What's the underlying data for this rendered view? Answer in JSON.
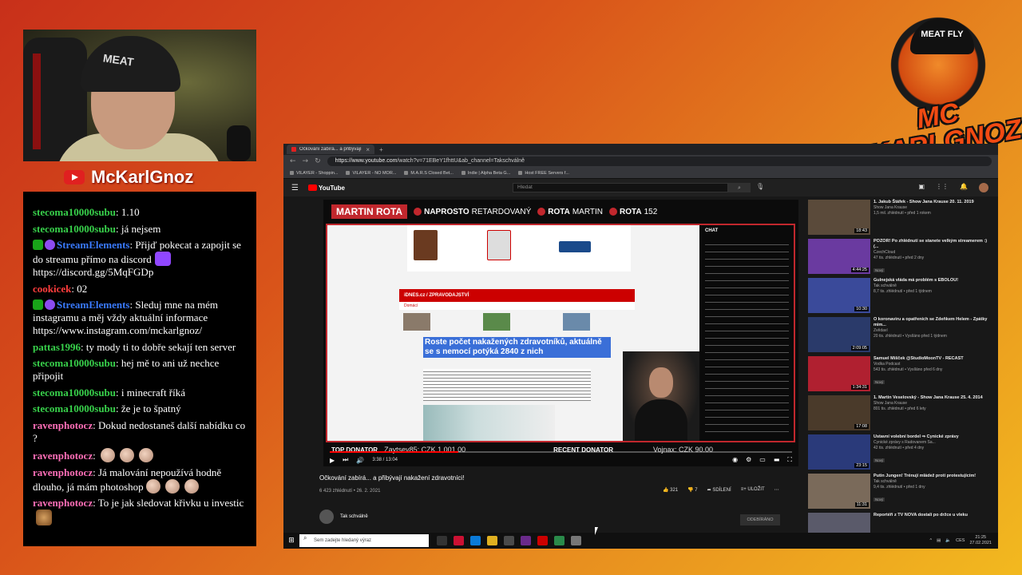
{
  "stream": {
    "channel_name": "McKarlGnoz",
    "logo_top": "MEAT FLY",
    "logo_name": "MC KARLGNOZ",
    "webcam_cap_text": "MEAT"
  },
  "chat": [
    {
      "user": "stecoma10000subu",
      "color": "green",
      "badges": [],
      "text": "1.10"
    },
    {
      "user": "stecoma10000subu",
      "color": "green",
      "badges": [],
      "text": "já nejsem"
    },
    {
      "user": "StreamElements",
      "color": "blue",
      "badges": [
        "mod",
        "bot"
      ],
      "text": "Přijď pokecat a zapojit se do streamu přímo na discord",
      "emote_after": "purple",
      "text2": "https://discord.gg/5MqFGDp"
    },
    {
      "user": "cookicek",
      "color": "red",
      "badges": [],
      "text": "02"
    },
    {
      "user": "StreamElements",
      "color": "blue",
      "badges": [
        "mod",
        "bot"
      ],
      "text": "Sleduj mne na mém instagramu a měj vždy aktuální informace https://www.instagram.com/mckarlgnoz/"
    },
    {
      "user": "pattas1996",
      "color": "green",
      "badges": [],
      "text": "ty mody ti to dobře sekají ten server"
    },
    {
      "user": "stecoma10000subu",
      "color": "green",
      "badges": [],
      "text": "hej mě to ani už nechce připojit"
    },
    {
      "user": "stecoma10000subu",
      "color": "green",
      "badges": [],
      "text": "i minecraft říká"
    },
    {
      "user": "stecoma10000subu",
      "color": "green",
      "badges": [],
      "text": "že je to špatný"
    },
    {
      "user": "ravenphotocz",
      "color": "pink",
      "badges": [],
      "text": "Dokud nedostaneš další nabídku co ?"
    },
    {
      "user": "ravenphotocz",
      "color": "pink",
      "badges": [],
      "text": "",
      "emotes": 3
    },
    {
      "user": "ravenphotocz",
      "color": "pink",
      "badges": [],
      "text": "Já malování nepoužívá hodně dlouho, já mám photoshop",
      "emotes": 3
    },
    {
      "user": "ravenphotocz",
      "color": "pink",
      "badges": [],
      "text": "To je jak sledovat křivku u investic",
      "emote_after": "face"
    }
  ],
  "browser": {
    "tab_title": "Očkování zabírá... a přibývají nové...",
    "url_host": "https://www.youtube.com",
    "url_path": "/watch?v=71EBeY1fhttU&ab_channel=Takschválně",
    "bookmarks": [
      "VILAYER - Shoppin...",
      "VILAYER - NO MOR...",
      "M.A.R.S Closed Bet...",
      "Indie | Alpha Beta G...",
      "Host FREE Servers f..."
    ],
    "search_placeholder": "Hledat"
  },
  "player": {
    "overlay_name": "MARTIN ROTA",
    "overlay_items": [
      {
        "bold": "NAPROSTO",
        "thin": "RETARDOVANÝ"
      },
      {
        "bold": "ROTA",
        "thin": "MARTIN"
      },
      {
        "bold": "ROTA",
        "thin": "152"
      }
    ],
    "site_bar": "iDNES.cz / ZPRAVODAJSTVÍ",
    "site_sub": "Domácí",
    "headline": "Roste počet nakažených zdravotníků, aktuálně se s nemocí potýká 2840 z nich",
    "stream_chat_title": "CHAT",
    "top_donator_label": "TOP DONATOR",
    "top_donator_value": "Zaytsev85: CZK 1,001.00",
    "recent_donator_label": "RECENT DONATOR",
    "recent_donator_value": "Vojnax: CZK 90.00",
    "time": "3:38 / 13:04",
    "progress": 0.278
  },
  "video": {
    "title": "Očkování zabírá... a přibývají nakažení zdravotníci!",
    "meta": "6 423 zhlédnutí • 26. 2. 2021",
    "likes": "321",
    "dislikes": "7",
    "share": "SDÍLENÍ",
    "save": "ULOŽIT",
    "channel": "Tak schválně",
    "subscribe": "ODEBÍRÁNO"
  },
  "recommended": [
    {
      "title": "1. Jakub Štáfek - Show Jana Krause 20. 11. 2019",
      "channel": "Show Jana Krause",
      "meta": "1,5 mil. zhlédnutí • před 1 rokem",
      "duration": "18:43",
      "new": false,
      "color": "#5a4a3a"
    },
    {
      "title": "POZOR! Po zhlédnutí se stanete velkým streamerem :) (...",
      "channel": "CzechCloud",
      "meta": "47 tis. zhlédnutí • před 2 dny",
      "duration": "4:44:25",
      "new": true,
      "color": "#6a3aa0"
    },
    {
      "title": "Gulnejská vláda má problém s EBOLOU!",
      "channel": "Tak schválně",
      "meta": "8,7 tis. zhlédnutí • před 1 týdnem",
      "duration": "10:30",
      "new": false,
      "color": "#3a4a9a"
    },
    {
      "title": "O koronaviru a opatřeních se Zdeňkem Helem - Zpátky mim...",
      "channel": "Zvědaví",
      "meta": "20 tis. zhlédnutí • Vysíláno před 1 týdnem",
      "duration": "2:09:05",
      "new": false,
      "color": "#2a3a6a"
    },
    {
      "title": "Samuel Mišček @StudioMoonTV - RECAST",
      "channel": "Vodka Podcast",
      "meta": "543 tis. zhlédnutí • Vysíláno před 6 dny",
      "duration": "1:34:31",
      "new": true,
      "color": "#b02030"
    },
    {
      "title": "1. Martin Veselovský - Show Jana Krause 25. 4. 2014",
      "channel": "Show Jana Krause",
      "meta": "801 tis. zhlédnutí • před 6 lety",
      "duration": "17:08",
      "new": false,
      "color": "#4a3a2a"
    },
    {
      "title": "Ustavní volební bordel ⇒ Cynické zprávy",
      "channel": "Cynické zprávy s Radovanem Sa...",
      "meta": "42 tis. zhlédnutí • před 4 dny",
      "duration": "23:15",
      "new": true,
      "color": "#2a3a7a"
    },
    {
      "title": "Putin Jungen! Trénují mládež proti protestujícím!",
      "channel": "Tak schválně",
      "meta": "9,4 tis. zhlédnutí • před 1 dny",
      "duration": "11:31",
      "new": true,
      "color": "#7a6a5a"
    },
    {
      "title": "Reportéři z TV NOVA dostali po držce u vleku",
      "channel": "",
      "meta": "",
      "duration": "",
      "new": false,
      "color": "#5a5a6a"
    }
  ],
  "taskbar": {
    "search_placeholder": "Sem zadejte hledaný výraz",
    "lang": "CES",
    "time": "21:25",
    "date": "27.02.2021"
  },
  "colors": {
    "accent_red": "#c1272d",
    "chat_green": "#38d14b",
    "chat_blue": "#3a7bff",
    "chat_pink": "#ff6fb8"
  }
}
